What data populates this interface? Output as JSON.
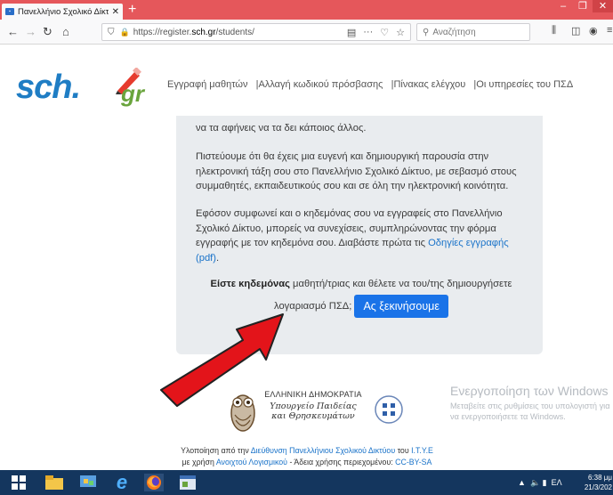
{
  "browser": {
    "tab_title": "Πανελλήνιο Σχολικό Δίκτυο - Ι",
    "tab_close": "✕",
    "new_tab": "+",
    "url_scheme": "https://register.",
    "url_host": "sch.gr",
    "url_path": "/students/",
    "search_placeholder": "Αναζήτηση",
    "colors": {
      "titlebar": "#e5575b",
      "navbar": "#f9f9fa"
    }
  },
  "header": {
    "logo_text": "sch.",
    "logo_tld": "gr",
    "nav": [
      "Εγγραφή μαθητών",
      "|Αλλαγή κωδικού πρόσβασης",
      "|Πίνακας ελέγχου",
      "|Οι υπηρεσίες του ΠΣΔ"
    ]
  },
  "content": {
    "p0": "να τα αφήνεις να τα δει κάποιος άλλος.",
    "p1": "Πιστεύουμε ότι θα έχεις μια ευγενή και δημιουργική παρουσία στην ηλεκτρονική τάξη σου στο Πανελλήνιο Σχολικό Δίκτυο, με σεβασμό στους συμμαθητές, εκπαιδευτικούς σου και σε όλη την ηλεκτρονική κοινότητα.",
    "p2_before": "Εφόσον συμφωνεί και ο κηδεμόνας σου να εγγραφείς στο Πανελλήνιο Σχολικό Δίκτυο, μπορείς να συνεχίσεις, συμπληρώνοντας την φόρμα εγγραφής με τον κηδεμόνα σου. Διαβάστε πρώτα τις ",
    "p2_link": "Οδηγίες εγγραφής (pdf)",
    "p2_after": ".",
    "q_bold": "Είστε κηδεμόνας",
    "q_text": " μαθητή/τριας και θέλετε να του/της δημιουργήσετε λογαριασμό ΠΣΔ;",
    "start_button": "Ας ξεκινήσουμε",
    "colors": {
      "card": "#e9ecef",
      "button": "#1a73e8",
      "arrow": "#e3141a"
    }
  },
  "footer": {
    "ministry_l1": "ΕΛΛΗΝΙΚΗ ΔΗΜΟΚΡΑΤΙΑ",
    "ministry_l2": "Υπουργείο Παιδείας",
    "ministry_l3": "και Θρησκευμάτων",
    "impl_prefix": "Υλοποίηση από την ",
    "impl_link1": "Διεύθυνση Πανελλήνιου Σχολικού Δικτύου",
    "impl_mid": " του ",
    "impl_link2": "Ι.Τ.Υ.Ε",
    "line2_prefix": "με χρήση ",
    "line2_link1": "Ανοιχτού Λογισμικού",
    "line2_mid": " - Άδεια χρήσης περιεχομένου: ",
    "line2_link2": "CC-BY-SA"
  },
  "watermark": {
    "title": "Ενεργοποίηση των Windows",
    "sub": "Μεταβείτε στις ρυθμίσεις του υπολογιστή για να ενεργοποιήσετε τα Windows."
  },
  "taskbar": {
    "lang": "ΕΛ",
    "time": "6:38 μμ",
    "date": "21/3/202"
  }
}
